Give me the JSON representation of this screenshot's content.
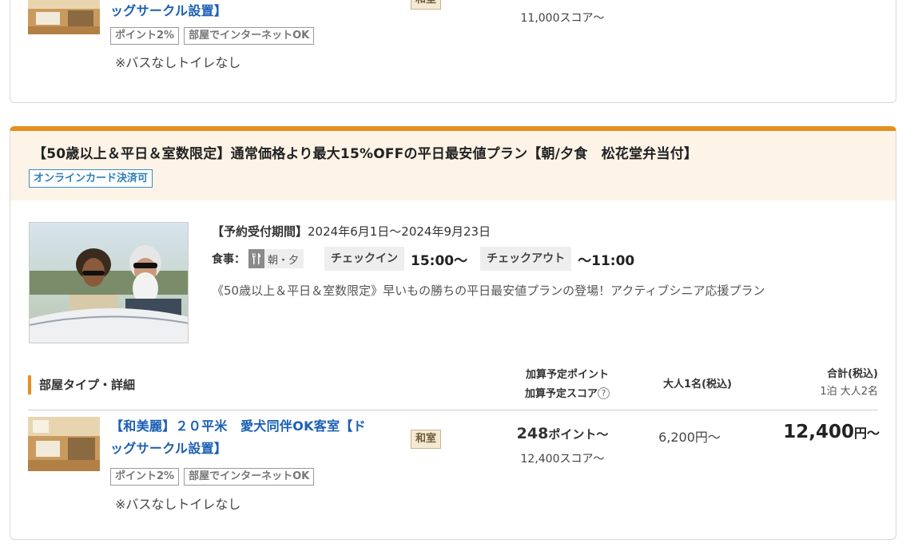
{
  "prev_room": {
    "name_line2": "ッグサークル設置】",
    "type_badge": "和室",
    "score": "11,000スコア〜",
    "tags": [
      "ポイント2%",
      "部屋でインターネットOK"
    ],
    "note": "※バスなしトイレなし"
  },
  "plan": {
    "title": "【50歳以上＆平日＆室数限定】通常価格より最大15%OFFの平日最安値プラン【朝/夕食　松花堂弁当付】",
    "payment_badge": "オンラインカード決済可",
    "period_label": "【予約受付期間】",
    "period_value": "2024年6月1日〜2024年9月23日",
    "meal_label": "食事：",
    "meal_value": "朝・夕",
    "checkin_label": "チェックイン",
    "checkin_value": "15:00〜",
    "checkout_label": "チェックアウト",
    "checkout_value": "〜11:00",
    "description": "《50歳以上＆平日＆室数限定》早いもの勝ちの平日最安値プランの登場！アクティブシニア応援プラン"
  },
  "room_table": {
    "section_label": "部屋タイプ・詳細",
    "col_points_1": "加算予定ポイント",
    "col_points_2": "加算予定スコア",
    "col_adult": "大人1名(税込)",
    "col_total": "合計(税込)",
    "col_total_sub": "1泊 大人2名"
  },
  "room": {
    "name_line1": "【和美麗】２０平米　愛犬同伴OK客室【ド",
    "name_line2": "ッグサークル設置】",
    "type_badge": "和室",
    "tags": [
      "ポイント2%",
      "部屋でインターネットOK"
    ],
    "note": "※バスなしトイレなし",
    "points": "248",
    "points_unit": "ポイント〜",
    "score": "12,400スコア〜",
    "adult_price": "6,200円〜",
    "total_price": "12,400",
    "total_unit": "円〜"
  }
}
